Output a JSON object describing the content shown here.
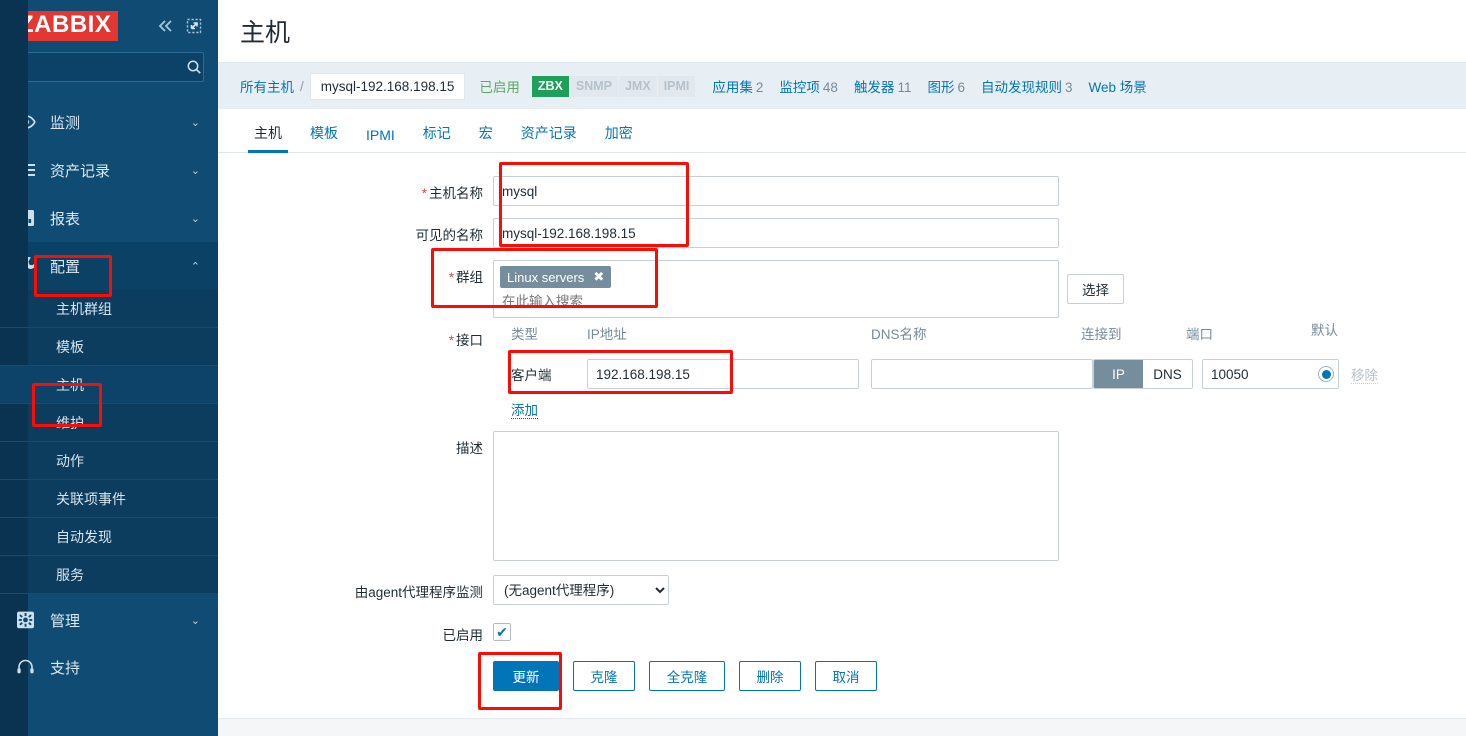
{
  "brand": {
    "logo": "ZABBIX",
    "collapse_icon": "chevrons-left-icon",
    "expand_icon": "expand-icon"
  },
  "sidebar": {
    "search_placeholder": "",
    "search_value": "",
    "items": [
      {
        "label": "监测",
        "icon": "eye-icon",
        "chevron": "⌄"
      },
      {
        "label": "资产记录",
        "icon": "list-icon",
        "chevron": "⌄"
      },
      {
        "label": "报表",
        "icon": "bar-chart-icon",
        "chevron": "⌄"
      },
      {
        "label": "配置",
        "icon": "wrench-icon",
        "chevron": "⌃"
      }
    ],
    "submenu": [
      {
        "label": "主机群组"
      },
      {
        "label": "模板"
      },
      {
        "label": "主机"
      },
      {
        "label": "维护"
      },
      {
        "label": "动作"
      },
      {
        "label": "关联项事件"
      },
      {
        "label": "自动发现"
      },
      {
        "label": "服务"
      }
    ],
    "admin": {
      "label": "管理",
      "icon": "gear-icon",
      "chevron": "⌄"
    },
    "support": {
      "label": "支持",
      "icon": "headset-icon"
    }
  },
  "header": {
    "title": "主机"
  },
  "breadcrumb": {
    "all_hosts": "所有主机",
    "separator": "/",
    "current": "mysql-192.168.198.15",
    "status": "已启用",
    "protocols": [
      {
        "label": "ZBX",
        "enabled": true
      },
      {
        "label": "SNMP",
        "enabled": false
      },
      {
        "label": "JMX",
        "enabled": false
      },
      {
        "label": "IPMI",
        "enabled": false
      }
    ],
    "stats": [
      {
        "label": "应用集",
        "count": "2"
      },
      {
        "label": "监控项",
        "count": "48"
      },
      {
        "label": "触发器",
        "count": "11"
      },
      {
        "label": "图形",
        "count": "6"
      },
      {
        "label": "自动发现规则",
        "count": "3"
      },
      {
        "label": "Web 场景",
        "count": ""
      }
    ]
  },
  "tabs": [
    {
      "label": "主机",
      "active": true
    },
    {
      "label": "模板",
      "active": false
    },
    {
      "label": "IPMI",
      "active": false
    },
    {
      "label": "标记",
      "active": false
    },
    {
      "label": "宏",
      "active": false
    },
    {
      "label": "资产记录",
      "active": false
    },
    {
      "label": "加密",
      "active": false
    }
  ],
  "form": {
    "host_name": {
      "label": "主机名称",
      "required": true,
      "value": "mysql"
    },
    "visible_name": {
      "label": "可见的名称",
      "required": false,
      "value": "mysql-192.168.198.15"
    },
    "groups": {
      "label": "群组",
      "required": true,
      "chips": [
        "Linux servers"
      ],
      "chip_remove_icon": "✖",
      "placeholder": "在此输入搜索",
      "select_button": "选择"
    },
    "interfaces": {
      "label": "接口",
      "required": true,
      "columns": {
        "type": "类型",
        "ip": "IP地址",
        "dns": "DNS名称",
        "connect_to": "连接到",
        "port": "端口",
        "default": "默认"
      },
      "rows": [
        {
          "type": "客户端",
          "ip": "192.168.198.15",
          "dns": "",
          "connect_to": {
            "options": [
              "IP",
              "DNS"
            ],
            "selected": "IP"
          },
          "port": "10050",
          "is_default": true,
          "remove_label": "移除"
        }
      ],
      "add_link": "添加"
    },
    "description": {
      "label": "描述",
      "value": ""
    },
    "proxy": {
      "label": "由agent代理程序监测",
      "selected": "(无agent代理程序)",
      "options": [
        "(无agent代理程序)"
      ]
    },
    "enabled": {
      "label": "已启用",
      "checked": true,
      "check_glyph": "✔"
    }
  },
  "actions": [
    {
      "label": "更新",
      "primary": true
    },
    {
      "label": "克隆",
      "primary": false
    },
    {
      "label": "全克隆",
      "primary": false
    },
    {
      "label": "删除",
      "primary": false
    },
    {
      "label": "取消",
      "primary": false
    }
  ],
  "colors": {
    "sidebar_bg": "#0f4b72",
    "logo_red": "#e33734",
    "accent_blue": "#0275b8",
    "status_green": "#59a869",
    "zbx_green": "#1fa05a",
    "highlight_red": "#fb0d06",
    "chip_grey": "#768d9e"
  }
}
